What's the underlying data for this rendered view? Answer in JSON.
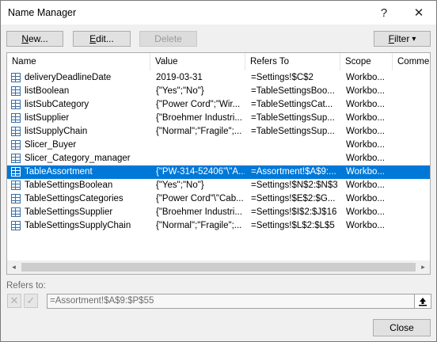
{
  "window": {
    "title": "Name Manager",
    "help": "?",
    "close": "✕"
  },
  "toolbar": {
    "new_label": "New...",
    "new_mnemonic": "N",
    "new_rest": "ew...",
    "edit_mnemonic": "E",
    "edit_rest": "dit...",
    "delete_label": "Delete",
    "filter_mnemonic": "F",
    "filter_rest": "ilter",
    "filter_arrow": "▾"
  },
  "columns": [
    "Name",
    "Value",
    "Refers To",
    "Scope",
    "Commer"
  ],
  "rows": [
    {
      "name": "deliveryDeadlineDate",
      "value": "2019-03-31",
      "refers": "=Settings!$C$2",
      "scope": "Workbo..."
    },
    {
      "name": "listBoolean",
      "value": "{\"Yes\";\"No\"}",
      "refers": "=TableSettingsBoo...",
      "scope": "Workbo..."
    },
    {
      "name": "listSubCategory",
      "value": "{\"Power Cord\";\"Wir...",
      "refers": "=TableSettingsCat...",
      "scope": "Workbo..."
    },
    {
      "name": "listSupplier",
      "value": "{\"Broehmer Industri...",
      "refers": "=TableSettingsSup...",
      "scope": "Workbo..."
    },
    {
      "name": "listSupplyChain",
      "value": "{\"Normal\";\"Fragile\";...",
      "refers": "=TableSettingsSup...",
      "scope": "Workbo..."
    },
    {
      "name": "Slicer_Buyer",
      "value": "",
      "refers": "",
      "scope": "Workbo..."
    },
    {
      "name": "Slicer_Category_manager",
      "value": "",
      "refers": "",
      "scope": "Workbo..."
    },
    {
      "name": "TableAssortment",
      "value": "{\"PW-314-52406\"\\\"A...",
      "refers": "=Assortment!$A$9:...",
      "scope": "Workbo...",
      "selected": true
    },
    {
      "name": "TableSettingsBoolean",
      "value": "{\"Yes\";\"No\"}",
      "refers": "=Settings!$N$2:$N$3",
      "scope": "Workbo..."
    },
    {
      "name": "TableSettingsCategories",
      "value": "{\"Power Cord\"\\\"Cab...",
      "refers": "=Settings!$E$2:$G...",
      "scope": "Workbo..."
    },
    {
      "name": "TableSettingsSupplier",
      "value": "{\"Broehmer Industri...",
      "refers": "=Settings!$I$2:$J$16",
      "scope": "Workbo..."
    },
    {
      "name": "TableSettingsSupplyChain",
      "value": "{\"Normal\";\"Fragile\";...",
      "refers": "=Settings!$L$2:$L$5",
      "scope": "Workbo..."
    }
  ],
  "refers_to": {
    "label": "Refers to:",
    "value": "=Assortment!$A$9:$P$55",
    "cancel_icon": "✕",
    "confirm_icon": "✓"
  },
  "footer": {
    "close_label": "Close"
  },
  "scrollbar": {
    "left": "◂",
    "right": "▸"
  },
  "colors": {
    "selection": "#0078d7",
    "icon": "#3a6ea5"
  }
}
